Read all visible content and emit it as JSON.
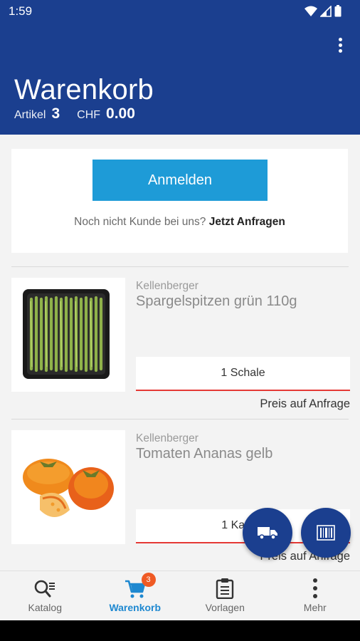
{
  "status": {
    "time": "1:59"
  },
  "header": {
    "title": "Warenkorb",
    "items_label": "Artikel",
    "items_count": "3",
    "currency": "CHF",
    "total": "0.00"
  },
  "login": {
    "button_label": "Anmelden",
    "hint_text": "Noch nicht Kunde bei uns?",
    "hint_link": "Jetzt Anfragen"
  },
  "products": [
    {
      "brand": "Kellenberger",
      "name": "Spargelspitzen grün 110g",
      "quantity": "1 Schale",
      "price": "Preis auf Anfrage",
      "image_icon": "asparagus-image"
    },
    {
      "brand": "Kellenberger",
      "name": "Tomaten Ananas gelb",
      "quantity": "1 Karton",
      "price": "Preis auf Anfrage",
      "image_icon": "tomato-image"
    }
  ],
  "fabs": [
    {
      "icon": "truck-icon"
    },
    {
      "icon": "barcode-icon"
    }
  ],
  "bottom_nav": {
    "items": [
      {
        "label": "Katalog",
        "icon": "catalog-search-icon",
        "active": false
      },
      {
        "label": "Warenkorb",
        "icon": "cart-icon",
        "active": true,
        "badge": "3"
      },
      {
        "label": "Vorlagen",
        "icon": "clipboard-icon",
        "active": false
      },
      {
        "label": "Mehr",
        "icon": "more-vertical-icon",
        "active": false
      }
    ]
  },
  "colors": {
    "primary": "#1b3f8f",
    "accent": "#1e9bd7",
    "active_nav": "#1e88d0",
    "badge": "#ef5a24",
    "underline": "#e53935"
  }
}
